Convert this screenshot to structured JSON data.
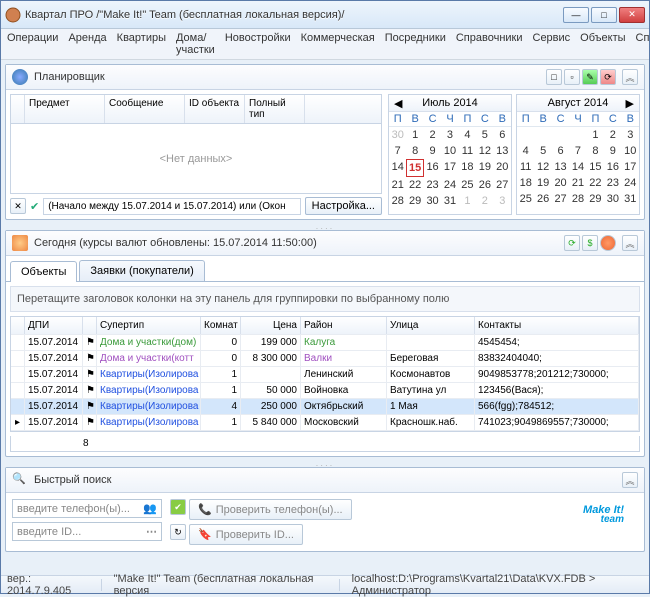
{
  "window_title": "Квартал ПРО /\"Make It!\" Team (бесплатная локальная версия)/",
  "menu": [
    "Операции",
    "Аренда",
    "Квартиры",
    "Дома/участки",
    "Новостройки",
    "Коммерческая",
    "Посредники",
    "Справочники",
    "Сервис",
    "Объекты",
    "Справка"
  ],
  "planner": {
    "title": "Планировщик",
    "cols": [
      "Предмет",
      "Сообщение",
      "ID объекта",
      "Полный тип"
    ],
    "empty": "<Нет данных>",
    "filter_text": "(Начало между 15.07.2014 и 15.07.2014) или (Окон",
    "settings_btn": "Настройка..."
  },
  "calendars": [
    {
      "title": "Июль 2014",
      "dow": [
        "П",
        "В",
        "С",
        "Ч",
        "П",
        "С",
        "В"
      ],
      "lead": [
        30
      ],
      "days": 31,
      "today": 15,
      "trail": [
        1,
        2,
        3
      ]
    },
    {
      "title": "Август 2014",
      "dow": [
        "П",
        "В",
        "С",
        "Ч",
        "П",
        "С",
        "В"
      ],
      "lead": [],
      "days": 31,
      "today": 0,
      "trail": [],
      "offset": 4
    }
  ],
  "today_panel": {
    "title": "Сегодня (курсы валют обновлены: 15.07.2014 11:50:00)"
  },
  "tabs": [
    "Объекты",
    "Заявки (покупатели)"
  ],
  "group_text": "Перетащите заголовок колонки на эту панель для группировки по выбранному полю",
  "grid": {
    "headers": [
      "",
      "ДПИ",
      "",
      "Супертип",
      "Комнат",
      "Цена",
      "Район",
      "Улица",
      "Контакты"
    ],
    "rows": [
      {
        "d": "15.07.2014",
        "t": "Дома и участки(дом)",
        "r": "0",
        "p": "199 000",
        "rn": "Калуга",
        "u": "",
        "k": "4545454;",
        "cls": "green"
      },
      {
        "d": "15.07.2014",
        "t": "Дома и участки(котт",
        "r": "0",
        "p": "8 300 000",
        "rn": "Валки",
        "u": "Береговая",
        "k": "83832404040;",
        "cls": "purple"
      },
      {
        "d": "15.07.2014",
        "t": "Квартиры(Изолирова",
        "r": "1",
        "p": "",
        "rn": "Ленинский",
        "u": "Космонавтов",
        "k": "9049853778;201212;730000;",
        "cls": "lnk"
      },
      {
        "d": "15.07.2014",
        "t": "Квартиры(Изолирова",
        "r": "1",
        "p": "50 000",
        "rn": "Войновка",
        "u": "Ватутина ул",
        "k": "123456(Вася);",
        "cls": "lnk"
      },
      {
        "d": "15.07.2014",
        "t": "Квартиры(Изолирова",
        "r": "4",
        "p": "250 000",
        "rn": "Октябрьский",
        "u": "1 Мая",
        "k": "566(fgg);784512;",
        "cls": "lnk",
        "sel": true
      },
      {
        "d": "15.07.2014",
        "t": "Квартиры(Изолирова",
        "r": "1",
        "p": "5 840 000",
        "rn": "Московский",
        "u": "Красношк.наб.",
        "k": "741023;9049869557;730000;",
        "cls": "lnk",
        "cur": true
      }
    ],
    "footer_count": "8"
  },
  "qsearch": {
    "title": "Быстрый поиск",
    "phone_ph": "введите телефон(ы)...",
    "id_ph": "введите ID...",
    "check_phone": "Проверить телефон(ы)...",
    "check_id": "Проверить ID..."
  },
  "logo": {
    "main": "Make It!",
    "sub": "team"
  },
  "status": {
    "ver": "вер.: 2014.7.9.405",
    "team": "\"Make It!\" Team (бесплатная локальная версия",
    "path": "localhost:D:\\Programs\\Kvartal21\\Data\\KVX.FDB > Администратор"
  }
}
